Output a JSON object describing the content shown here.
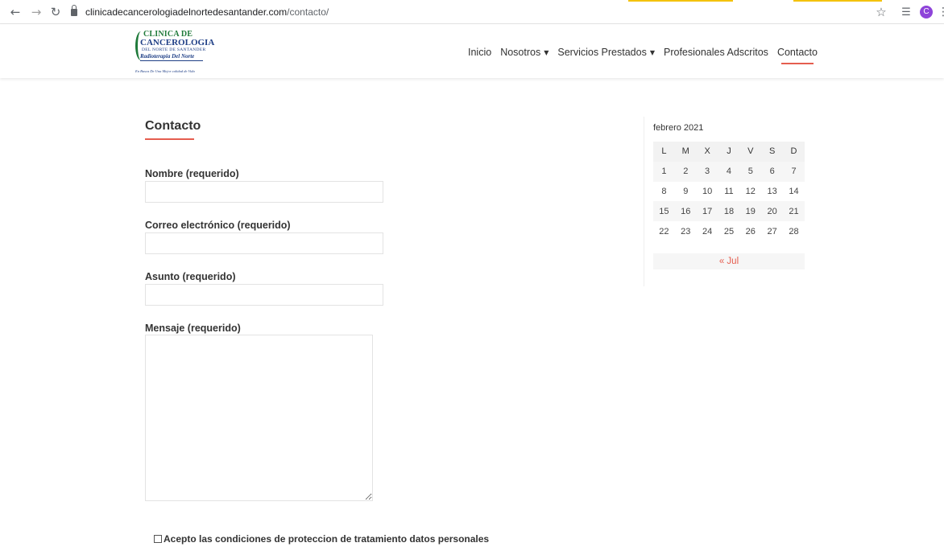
{
  "browser": {
    "url_domain": "clinicadecancerologiadelnortedesantander.com",
    "url_path": "/contacto/",
    "profile_initial": "C",
    "icons": [
      "back-arrow-icon",
      "forward-arrow-icon",
      "reload-icon",
      "lock-icon",
      "star-icon",
      "reading-list-icon",
      "menu-dots-icon"
    ]
  },
  "logo": {
    "line1": "CLINICA DE",
    "line2": "CANCEROLOGIA",
    "line3": "DEL NORTE DE SANTANDER",
    "line4": "Radioterapia Del Norte",
    "tagline": "En Busca De Una Mejor calidad de Vida"
  },
  "nav": {
    "items": [
      {
        "label": "Inicio",
        "has_dropdown": false
      },
      {
        "label": "Nosotros",
        "has_dropdown": true
      },
      {
        "label": "Servicios Prestados",
        "has_dropdown": true
      },
      {
        "label": "Profesionales Adscritos",
        "has_dropdown": false
      },
      {
        "label": "Contacto",
        "has_dropdown": false,
        "active": true
      }
    ],
    "caret": "▼"
  },
  "page": {
    "title": "Contacto"
  },
  "form": {
    "name_label": "Nombre (requerido)",
    "name_value": "",
    "email_label": "Correo electrónico (requerido)",
    "email_value": "",
    "subject_label": "Asunto (requerido)",
    "subject_value": "",
    "message_label": "Mensaje (requerido)",
    "message_value": "",
    "consent_label": "Acepto las condiciones de proteccion de tratamiento datos personales",
    "consent_checked": false
  },
  "calendar": {
    "caption": "febrero 2021",
    "weekdays": [
      "L",
      "M",
      "X",
      "J",
      "V",
      "S",
      "D"
    ],
    "weeks": [
      [
        "1",
        "2",
        "3",
        "4",
        "5",
        "6",
        "7"
      ],
      [
        "8",
        "9",
        "10",
        "11",
        "12",
        "13",
        "14"
      ],
      [
        "15",
        "16",
        "17",
        "18",
        "19",
        "20",
        "21"
      ],
      [
        "22",
        "23",
        "24",
        "25",
        "26",
        "27",
        "28"
      ]
    ],
    "prev_link": "« Jul"
  },
  "colors": {
    "accent": "#e55d4f",
    "logo_green": "#1f7a3a",
    "logo_blue": "#1f3f86",
    "profile": "#8e44d9"
  }
}
